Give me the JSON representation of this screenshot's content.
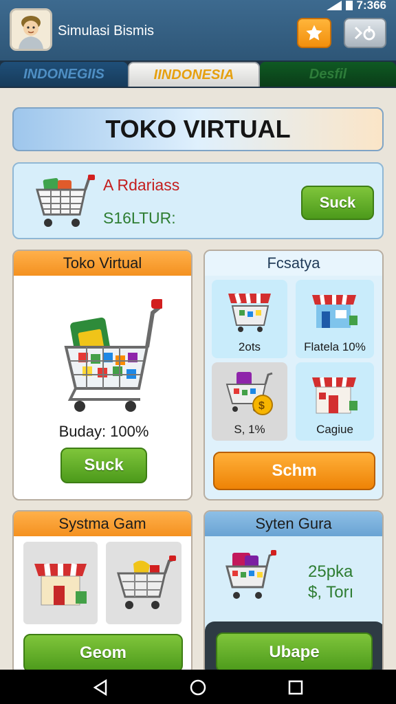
{
  "status": {
    "time": "7:366"
  },
  "header": {
    "title": "Simulasi Bismis"
  },
  "tabs": [
    {
      "label": "INDONEGIIS"
    },
    {
      "label": "IINDONESIA"
    },
    {
      "label": "Desfil"
    }
  ],
  "banner": {
    "title": "TOKO VIRTUAL"
  },
  "summary": {
    "name": "A Rdariass",
    "money": "S16LTUR:",
    "button": "Suck"
  },
  "panel_store": {
    "title": "Toko Virtual",
    "budget": "Buday: 100%",
    "button": "Suck"
  },
  "panel_features": {
    "title": "Fcsatya",
    "tiles": [
      {
        "label": "2ots"
      },
      {
        "label": "Flatela 10%"
      },
      {
        "label": "S, 1%"
      },
      {
        "label": "Cagiue"
      }
    ],
    "button": "Schm"
  },
  "panel_system": {
    "title": "Systma Gam",
    "button": "Geom"
  },
  "panel_guide": {
    "title": "Syten Gura",
    "value1": "25pka",
    "value2": "$, Torı",
    "button": "Ubape"
  },
  "colors": {
    "accent_orange": "#f49120",
    "accent_green": "#4c9a1b",
    "header_blue": "#2e5677"
  }
}
